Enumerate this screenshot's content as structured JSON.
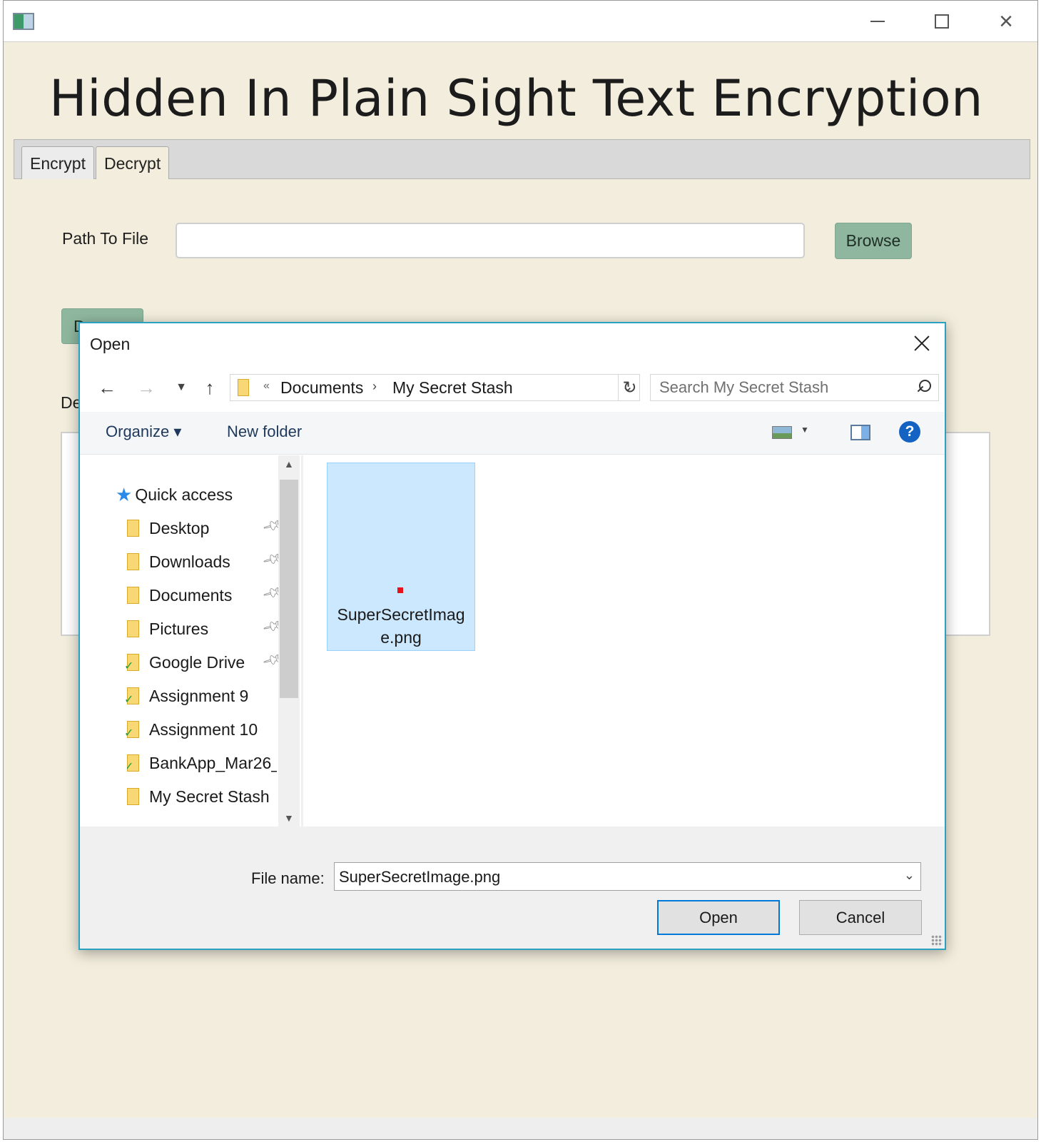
{
  "app": {
    "title": "Hidden In Plain Sight Text Encryption",
    "tabs": [
      {
        "label": "Encrypt"
      },
      {
        "label": "Decrypt"
      }
    ],
    "path_label": "Path To File",
    "path_value": "",
    "browse_label": "Browse",
    "decrypt_button_label": "D",
    "decrypted_label": "De"
  },
  "dialog": {
    "title": "Open",
    "breadcrumb": [
      "Documents",
      "My Secret Stash"
    ],
    "breadcrumb_overflow": "«",
    "search_placeholder": "Search My Secret Stash",
    "toolbar": {
      "organize": "Organize ▾",
      "new_folder": "New folder",
      "help": "?"
    },
    "nav": {
      "quick_access": "Quick access",
      "items": [
        {
          "label": "Desktop",
          "pinned": true
        },
        {
          "label": "Downloads",
          "pinned": true
        },
        {
          "label": "Documents",
          "pinned": true
        },
        {
          "label": "Pictures",
          "pinned": true
        },
        {
          "label": "Google Drive",
          "pinned": true
        },
        {
          "label": "Assignment 9",
          "pinned": false
        },
        {
          "label": "Assignment 10",
          "pinned": false
        },
        {
          "label": "BankApp_Mar26_",
          "pinned": false
        },
        {
          "label": "My Secret Stash",
          "pinned": false
        }
      ]
    },
    "files": [
      {
        "name": "SuperSecretImage.png",
        "selected": true
      }
    ],
    "footer": {
      "file_name_label": "File name:",
      "file_name_value": "SuperSecretImage.png",
      "open_label": "Open",
      "cancel_label": "Cancel"
    }
  },
  "colors": {
    "app_background": "#f2eddc",
    "button_green": "#8fb79f",
    "dialog_border": "#2aa1c0",
    "selection": "#cce8ff",
    "help_blue": "#1463c3"
  }
}
